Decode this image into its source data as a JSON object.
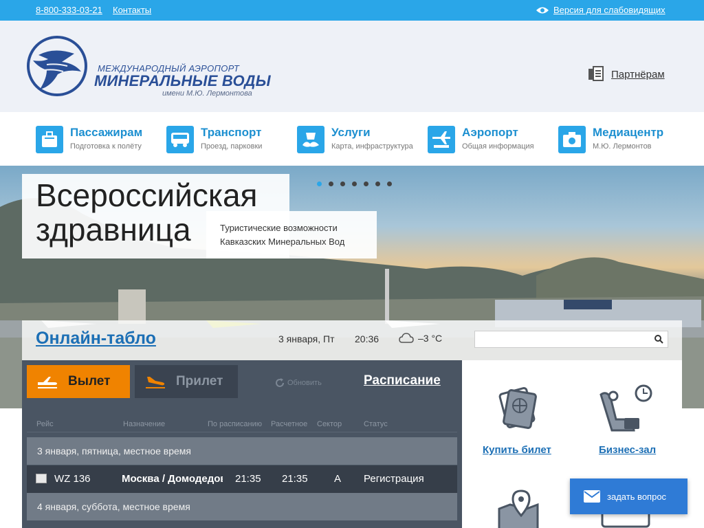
{
  "topbar": {
    "phone": "8-800-333-03-21",
    "contacts": "Контакты",
    "accessibility": "Версия для слабовидящих"
  },
  "header": {
    "logo_line1": "МЕЖДУНАРОДНЫЙ АЭРОПОРТ",
    "logo_line2": "МИНЕРАЛЬНЫЕ ВОДЫ",
    "logo_line3": "имени М.Ю. Лермонтова",
    "partners": "Партнёрам"
  },
  "nav": {
    "items": [
      {
        "title": "Пассажирам",
        "sub": "Подготовка к полёту",
        "icon": "suitcase-icon"
      },
      {
        "title": "Транспорт",
        "sub": "Проезд, парковки",
        "icon": "bus-icon"
      },
      {
        "title": "Услуги",
        "sub": "Карта, инфраструктура",
        "icon": "services-icon"
      },
      {
        "title": "Аэропорт",
        "sub": "Общая информация",
        "icon": "plane-icon"
      },
      {
        "title": "Медиацентр",
        "sub": "М.Ю. Лермонтов",
        "icon": "camera-icon"
      }
    ]
  },
  "hero": {
    "title_line1": "Всероссийская",
    "title_line2": "здравница",
    "subtitle_line1": "Туристические возможности",
    "subtitle_line2": "Кавказских Минеральных Вод",
    "slide_count": 7,
    "active_slide": 1
  },
  "board": {
    "title": "Онлайн-табло",
    "date": "3 января, Пт",
    "time": "20:36",
    "temperature": "–3 °C",
    "search_placeholder": ""
  },
  "flights": {
    "departure_label": "Вылет",
    "arrival_label": "Прилет",
    "refresh_label": "Обновить",
    "schedule_label": "Расписание",
    "columns": [
      "Рейс",
      "Назначение",
      "По расписанию",
      "Расчетное",
      "Сектор",
      "Статус"
    ],
    "date_row_1": "3 января, пятница, местное время",
    "date_row_2": "4 января, суббота, местное время",
    "rows": [
      {
        "flight": "WZ 136",
        "destination": "Москва / Домодедово",
        "scheduled": "21:35",
        "estimated": "21:35",
        "sector": "A",
        "status": "Регистрация"
      }
    ]
  },
  "services": {
    "buy_ticket": "Купить билет",
    "business_lounge": "Бизнес-зал"
  },
  "ask": {
    "label": "задать вопрос"
  },
  "colors": {
    "accent": "#2aa6e8",
    "brand": "#2a4f97",
    "departure": "#f08300",
    "panel": "#4a5563",
    "ask": "#2f7bd6"
  }
}
